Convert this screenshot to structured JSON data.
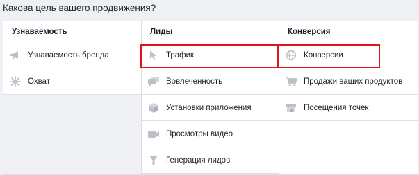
{
  "question": "Какова цель вашего продвижения?",
  "columns": [
    {
      "header": "Узнаваемость",
      "items": [
        {
          "label": "Узнаваемость бренда",
          "icon": "megaphone-icon"
        },
        {
          "label": "Охват",
          "icon": "snowflake-icon"
        }
      ]
    },
    {
      "header": "Лиды",
      "items": [
        {
          "label": "Трафик",
          "icon": "cursor-icon"
        },
        {
          "label": "Вовлеченность",
          "icon": "speech-bubbles-icon"
        },
        {
          "label": "Установки приложения",
          "icon": "box-icon"
        },
        {
          "label": "Просмотры видео",
          "icon": "video-camera-icon"
        },
        {
          "label": "Генерация лидов",
          "icon": "funnel-icon"
        }
      ]
    },
    {
      "header": "Конверсия",
      "items": [
        {
          "label": "Конверсии",
          "icon": "globe-icon"
        },
        {
          "label": "Продажи ваших продуктов",
          "icon": "cart-icon"
        },
        {
          "label": "Посещения точек",
          "icon": "storefront-icon"
        }
      ]
    }
  ],
  "colors": {
    "highlight": "#e3121c",
    "icon": "#bcc0c8",
    "border": "#dcdee3",
    "background": "#eef0f4"
  }
}
